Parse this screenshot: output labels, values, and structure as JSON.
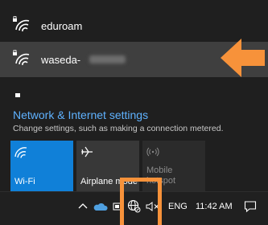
{
  "networks": [
    {
      "name": "eduroam",
      "icon": "wifi-secured-icon",
      "selected": false
    },
    {
      "name": "waseda-",
      "icon": "wifi-secured-icon",
      "selected": true
    }
  ],
  "settings": {
    "title": "Network & Internet settings",
    "subtitle": "Change settings, such as making a connection metered."
  },
  "quick_actions": [
    {
      "label": "Wi-Fi",
      "icon": "wifi-icon",
      "active": true
    },
    {
      "label": "Airplane mode",
      "icon": "airplane-icon",
      "active": false
    },
    {
      "label": "Mobile hotspot",
      "icon": "mobile-hotspot-icon",
      "active": false,
      "disabled": true
    }
  ],
  "taskbar": {
    "language": "ENG",
    "time": "11:42 AM",
    "icons": [
      "chevron-up-icon",
      "onedrive-icon",
      "battery-icon",
      "network-globe-icon",
      "volume-muted-icon",
      "notifications-icon"
    ]
  },
  "colors": {
    "accent": "#1080d8",
    "link": "#5fb2ff",
    "highlight": "#f7923a"
  }
}
